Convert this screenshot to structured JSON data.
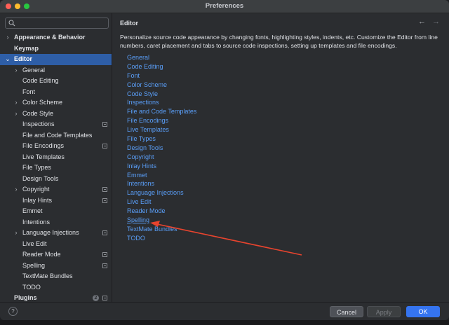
{
  "window": {
    "title": "Preferences"
  },
  "search": {
    "placeholder": "",
    "value": "",
    "icon": "search-icon"
  },
  "sidebar": {
    "items": [
      {
        "label": "Appearance & Behavior",
        "level": 0,
        "chevron": "›",
        "bold": true
      },
      {
        "label": "Keymap",
        "level": 0,
        "chevron": "",
        "bold": true
      },
      {
        "label": "Editor",
        "level": 0,
        "chevron": "⌄",
        "bold": true,
        "selected": true
      },
      {
        "label": "General",
        "level": 1,
        "chevron": "›"
      },
      {
        "label": "Code Editing",
        "level": 1,
        "chevron": ""
      },
      {
        "label": "Font",
        "level": 1,
        "chevron": ""
      },
      {
        "label": "Color Scheme",
        "level": 1,
        "chevron": "›"
      },
      {
        "label": "Code Style",
        "level": 1,
        "chevron": "›"
      },
      {
        "label": "Inspections",
        "level": 1,
        "chevron": "",
        "badge": true
      },
      {
        "label": "File and Code Templates",
        "level": 1,
        "chevron": ""
      },
      {
        "label": "File Encodings",
        "level": 1,
        "chevron": "",
        "badge": true
      },
      {
        "label": "Live Templates",
        "level": 1,
        "chevron": ""
      },
      {
        "label": "File Types",
        "level": 1,
        "chevron": ""
      },
      {
        "label": "Design Tools",
        "level": 1,
        "chevron": ""
      },
      {
        "label": "Copyright",
        "level": 1,
        "chevron": "›",
        "badge": true
      },
      {
        "label": "Inlay Hints",
        "level": 1,
        "chevron": "",
        "badge": true
      },
      {
        "label": "Emmet",
        "level": 1,
        "chevron": ""
      },
      {
        "label": "Intentions",
        "level": 1,
        "chevron": ""
      },
      {
        "label": "Language Injections",
        "level": 1,
        "chevron": "›",
        "badge": true
      },
      {
        "label": "Live Edit",
        "level": 1,
        "chevron": ""
      },
      {
        "label": "Reader Mode",
        "level": 1,
        "chevron": "",
        "badge": true
      },
      {
        "label": "Spelling",
        "level": 1,
        "chevron": "",
        "badge": true
      },
      {
        "label": "TextMate Bundles",
        "level": 1,
        "chevron": ""
      },
      {
        "label": "TODO",
        "level": 1,
        "chevron": ""
      },
      {
        "label": "Plugins",
        "level": 0,
        "chevron": "",
        "bold": true,
        "count": "2",
        "badge": true
      }
    ]
  },
  "content": {
    "breadcrumb": "Editor",
    "back_icon": "←",
    "forward_icon": "→",
    "description": "Personalize source code appearance by changing fonts, highlighting styles, indents, etc. Customize the Editor from line numbers, caret placement and tabs to source code inspections, setting up templates and file encodings.",
    "links": [
      "General",
      "Code Editing",
      "Font",
      "Color Scheme",
      "Code Style",
      "Inspections",
      "File and Code Templates",
      "File Encodings",
      "Live Templates",
      "File Types",
      "Design Tools",
      "Copyright",
      "Inlay Hints",
      "Emmet",
      "Intentions",
      "Language Injections",
      "Live Edit",
      "Reader Mode",
      "Spelling",
      "TextMate Bundles",
      "TODO"
    ],
    "hovered_link": "Spelling"
  },
  "footer": {
    "help": "?",
    "cancel": "Cancel",
    "apply": "Apply",
    "ok": "OK"
  },
  "colors": {
    "accent": "#3574f0",
    "selection": "#2e5ea7",
    "link": "#5a9ef7",
    "annotation_arrow": "#e8442e"
  }
}
